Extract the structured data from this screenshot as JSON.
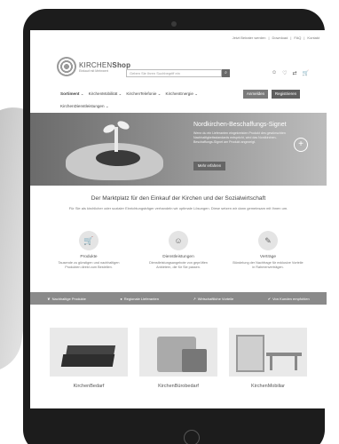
{
  "util_links": [
    "Jetzt Beirater werden",
    "Download",
    "FAQ",
    "Kontakt"
  ],
  "brand": {
    "name_light": "KIRCHEN",
    "name_bold": "Shop",
    "tagline": "Einkauf mit Mehrwert"
  },
  "search": {
    "placeholder": "Geben Sie Ihren Suchbegriff ein"
  },
  "header_icons": [
    "user-icon",
    "heart-icon",
    "compare-icon",
    "cart-icon"
  ],
  "nav": {
    "items": [
      "Sortiment",
      "KirchenMobilität",
      "KirchenTelefonie",
      "KirchenEnergie"
    ],
    "second_row": "KirchenDienstleistungen",
    "login_label": "Anmelden",
    "register_label": "Registrieren"
  },
  "hero": {
    "title": "Nordkirchen-Beschaffungs-Signet",
    "text": "Wenn du ein Lieferanten eingekreisten Produkt des gewünschten Nachhaltigkeitsstandards entspricht, wird das Nordkirchen-Beschaffungs-Signet am Produkt angezeigt.",
    "button_label": "Mehr erfahren"
  },
  "marketplace": {
    "title": "Der Marktplatz für den Einkauf der Kirchen und der Sozialwirtschaft",
    "subtitle": "Für Sie als kirchlicher oder sozialer Einrichtungsträger verhandeln wir optimale Lösungen. Diese setzen wir dann gemeinsam mit Ihnen um."
  },
  "features": [
    {
      "icon": "cart-icon",
      "title": "Produkte",
      "text": "Tausende zu günstigen und nachhaltigen Produkten direkt zum Bestellen."
    },
    {
      "icon": "service-icon",
      "title": "Dienstleistungen",
      "text": "Dienstleistungsangebote von geprüften Anbietern, die für Sie passen."
    },
    {
      "icon": "contract-icon",
      "title": "Verträge",
      "text": "Bündelung der Nachfrage für exklusive Vorteile in Rahmenverträgen."
    }
  ],
  "bar_items": [
    "Nachhaltige Produkte",
    "Regionale Lieferanten",
    "Wirtschaftliche Vorteile",
    "Von Kunden empfohlen"
  ],
  "categories": [
    "KirchenBedarf",
    "KirchenBürobedarf",
    "KirchenMobiliar"
  ],
  "colors": {
    "hero_bg": "#7a7a7a",
    "bar_bg": "#8a8a8a",
    "button_dark": "#5f5f5f"
  }
}
